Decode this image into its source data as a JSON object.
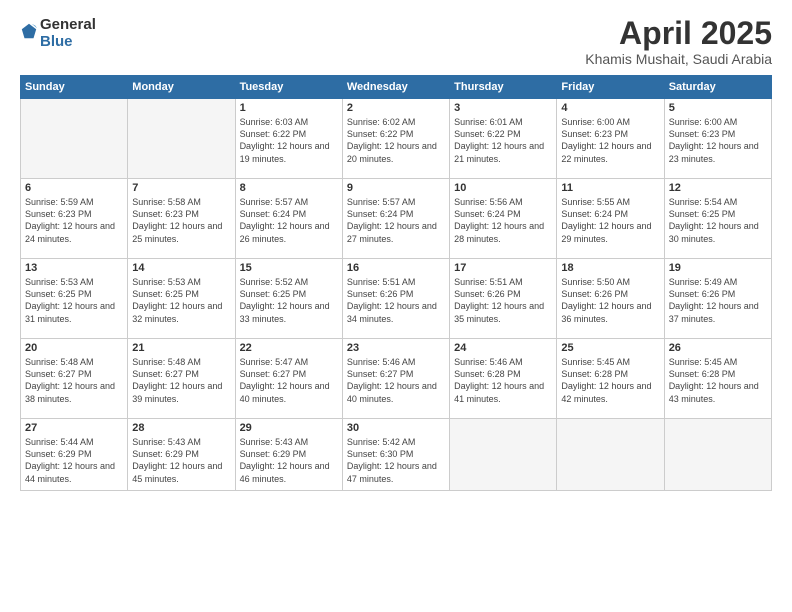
{
  "logo": {
    "text_general": "General",
    "text_blue": "Blue"
  },
  "header": {
    "month_title": "April 2025",
    "location": "Khamis Mushait, Saudi Arabia"
  },
  "weekdays": [
    "Sunday",
    "Monday",
    "Tuesday",
    "Wednesday",
    "Thursday",
    "Friday",
    "Saturday"
  ],
  "weeks": [
    [
      {
        "day": "",
        "info": ""
      },
      {
        "day": "",
        "info": ""
      },
      {
        "day": "1",
        "info": "Sunrise: 6:03 AM\nSunset: 6:22 PM\nDaylight: 12 hours\nand 19 minutes."
      },
      {
        "day": "2",
        "info": "Sunrise: 6:02 AM\nSunset: 6:22 PM\nDaylight: 12 hours\nand 20 minutes."
      },
      {
        "day": "3",
        "info": "Sunrise: 6:01 AM\nSunset: 6:22 PM\nDaylight: 12 hours\nand 21 minutes."
      },
      {
        "day": "4",
        "info": "Sunrise: 6:00 AM\nSunset: 6:23 PM\nDaylight: 12 hours\nand 22 minutes."
      },
      {
        "day": "5",
        "info": "Sunrise: 6:00 AM\nSunset: 6:23 PM\nDaylight: 12 hours\nand 23 minutes."
      }
    ],
    [
      {
        "day": "6",
        "info": "Sunrise: 5:59 AM\nSunset: 6:23 PM\nDaylight: 12 hours\nand 24 minutes."
      },
      {
        "day": "7",
        "info": "Sunrise: 5:58 AM\nSunset: 6:23 PM\nDaylight: 12 hours\nand 25 minutes."
      },
      {
        "day": "8",
        "info": "Sunrise: 5:57 AM\nSunset: 6:24 PM\nDaylight: 12 hours\nand 26 minutes."
      },
      {
        "day": "9",
        "info": "Sunrise: 5:57 AM\nSunset: 6:24 PM\nDaylight: 12 hours\nand 27 minutes."
      },
      {
        "day": "10",
        "info": "Sunrise: 5:56 AM\nSunset: 6:24 PM\nDaylight: 12 hours\nand 28 minutes."
      },
      {
        "day": "11",
        "info": "Sunrise: 5:55 AM\nSunset: 6:24 PM\nDaylight: 12 hours\nand 29 minutes."
      },
      {
        "day": "12",
        "info": "Sunrise: 5:54 AM\nSunset: 6:25 PM\nDaylight: 12 hours\nand 30 minutes."
      }
    ],
    [
      {
        "day": "13",
        "info": "Sunrise: 5:53 AM\nSunset: 6:25 PM\nDaylight: 12 hours\nand 31 minutes."
      },
      {
        "day": "14",
        "info": "Sunrise: 5:53 AM\nSunset: 6:25 PM\nDaylight: 12 hours\nand 32 minutes."
      },
      {
        "day": "15",
        "info": "Sunrise: 5:52 AM\nSunset: 6:25 PM\nDaylight: 12 hours\nand 33 minutes."
      },
      {
        "day": "16",
        "info": "Sunrise: 5:51 AM\nSunset: 6:26 PM\nDaylight: 12 hours\nand 34 minutes."
      },
      {
        "day": "17",
        "info": "Sunrise: 5:51 AM\nSunset: 6:26 PM\nDaylight: 12 hours\nand 35 minutes."
      },
      {
        "day": "18",
        "info": "Sunrise: 5:50 AM\nSunset: 6:26 PM\nDaylight: 12 hours\nand 36 minutes."
      },
      {
        "day": "19",
        "info": "Sunrise: 5:49 AM\nSunset: 6:26 PM\nDaylight: 12 hours\nand 37 minutes."
      }
    ],
    [
      {
        "day": "20",
        "info": "Sunrise: 5:48 AM\nSunset: 6:27 PM\nDaylight: 12 hours\nand 38 minutes."
      },
      {
        "day": "21",
        "info": "Sunrise: 5:48 AM\nSunset: 6:27 PM\nDaylight: 12 hours\nand 39 minutes."
      },
      {
        "day": "22",
        "info": "Sunrise: 5:47 AM\nSunset: 6:27 PM\nDaylight: 12 hours\nand 40 minutes."
      },
      {
        "day": "23",
        "info": "Sunrise: 5:46 AM\nSunset: 6:27 PM\nDaylight: 12 hours\nand 40 minutes."
      },
      {
        "day": "24",
        "info": "Sunrise: 5:46 AM\nSunset: 6:28 PM\nDaylight: 12 hours\nand 41 minutes."
      },
      {
        "day": "25",
        "info": "Sunrise: 5:45 AM\nSunset: 6:28 PM\nDaylight: 12 hours\nand 42 minutes."
      },
      {
        "day": "26",
        "info": "Sunrise: 5:45 AM\nSunset: 6:28 PM\nDaylight: 12 hours\nand 43 minutes."
      }
    ],
    [
      {
        "day": "27",
        "info": "Sunrise: 5:44 AM\nSunset: 6:29 PM\nDaylight: 12 hours\nand 44 minutes."
      },
      {
        "day": "28",
        "info": "Sunrise: 5:43 AM\nSunset: 6:29 PM\nDaylight: 12 hours\nand 45 minutes."
      },
      {
        "day": "29",
        "info": "Sunrise: 5:43 AM\nSunset: 6:29 PM\nDaylight: 12 hours\nand 46 minutes."
      },
      {
        "day": "30",
        "info": "Sunrise: 5:42 AM\nSunset: 6:30 PM\nDaylight: 12 hours\nand 47 minutes."
      },
      {
        "day": "",
        "info": ""
      },
      {
        "day": "",
        "info": ""
      },
      {
        "day": "",
        "info": ""
      }
    ]
  ]
}
